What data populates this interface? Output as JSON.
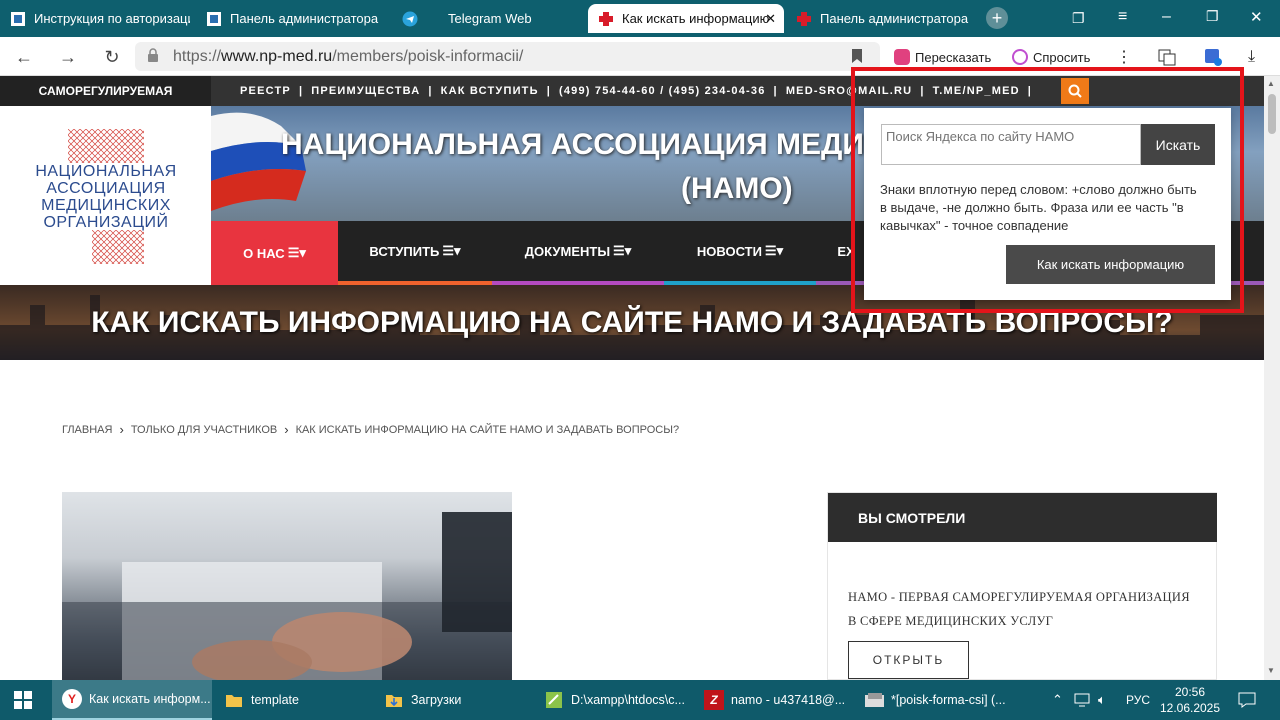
{
  "browser": {
    "tabs": [
      {
        "label": "Инструкция по авторизации",
        "icon": "site-icon",
        "active": false
      },
      {
        "label": "Панель администратора",
        "icon": "site-icon",
        "active": false
      },
      {
        "label": "Telegram Web",
        "icon": "telegram-icon",
        "active": false
      },
      {
        "label": "Как искать информацию",
        "icon": "red-cross-icon",
        "active": true
      },
      {
        "label": "Панель администратора",
        "icon": "red-cross-icon",
        "active": false
      }
    ],
    "url_prefix": "https://",
    "url_domain": "www.np-med.ru",
    "url_path": "/members/poisk-informacii/",
    "retell_label": "Пересказать",
    "ask_label": "Спросить"
  },
  "site": {
    "sro_badge": "САМОРЕГУЛИРУЕМАЯ",
    "top_links": [
      "РЕЕСТР",
      "ПРЕИМУЩЕСТВА",
      "КАК ВСТУПИТЬ",
      "(499) 754-44-60 / (495) 234-04-36",
      "MED-SRO@MAIL.RU",
      "T.ME/NP_MED"
    ],
    "logo_lines": [
      "НАЦИОНАЛЬНАЯ",
      "АССОЦИАЦИЯ",
      "МЕДИЦИНСКИХ",
      "ОРГАНИЗАЦИЙ"
    ],
    "hero_title": "НАЦИОНАЛЬНАЯ АССОЦИАЦИЯ МЕДИЦ",
    "hero_sub": "(НАМО)",
    "nav": [
      {
        "label": "О НАС",
        "color": "#e8343f"
      },
      {
        "label": "ВСТУПИТЬ",
        "color": "#f0622d"
      },
      {
        "label": "ДОКУМЕНТЫ",
        "color": "#b44ac0"
      },
      {
        "label": "НОВОСТИ",
        "color": "#1fa0c9"
      },
      {
        "label": "ЕХ",
        "color": "#9b59b6"
      }
    ],
    "page_title": "КАК ИСКАТЬ ИНФОРМАЦИЮ НА САЙТЕ НАМО И ЗАДАВАТЬ ВОПРОСЫ?",
    "breadcrumb": [
      "ГЛАВНАЯ",
      "ТОЛЬКО ДЛЯ УЧАСТНИКОВ",
      "КАК ИСКАТЬ ИНФОРМАЦИЮ НА САЙТЕ НАМО И ЗАДАВАТЬ ВОПРОСЫ?"
    ],
    "sidebar": {
      "heading": "ВЫ СМОТРЕЛИ",
      "text": "НАМО - ПЕРВАЯ САМОРЕГУЛИРУЕМАЯ ОРГАНИЗАЦИЯ В СФЕРЕ МЕДИЦИНСКИХ УСЛУГ",
      "button": "ОТКРЫТЬ"
    },
    "search_popup": {
      "placeholder": "Поиск Яндекса по сайту НАМО",
      "search_button": "Искать",
      "hint": "Знаки вплотную перед словом: +слово должно быть в выдаче, -не должно быть. Фраза или ее часть \"в кавычках\" - точное совпадение",
      "how_button": "Как искать информацию"
    }
  },
  "taskbar": {
    "items": [
      {
        "label": "Как искать информ...",
        "icon": "yandex-icon",
        "active": true
      },
      {
        "label": "template",
        "icon": "folder-icon",
        "active": false
      },
      {
        "label": "Загрузки",
        "icon": "downloads-icon",
        "active": false
      },
      {
        "label": "D:\\xampp\\htdocs\\c...",
        "icon": "editor-icon",
        "active": false
      },
      {
        "label": "namo - u437418@...",
        "icon": "filezilla-icon",
        "active": false
      },
      {
        "label": "*[poisk-forma-csi] (...",
        "icon": "app-icon",
        "active": false
      }
    ],
    "lang": "РУС",
    "time": "20:56",
    "date": "12.06.2025"
  }
}
